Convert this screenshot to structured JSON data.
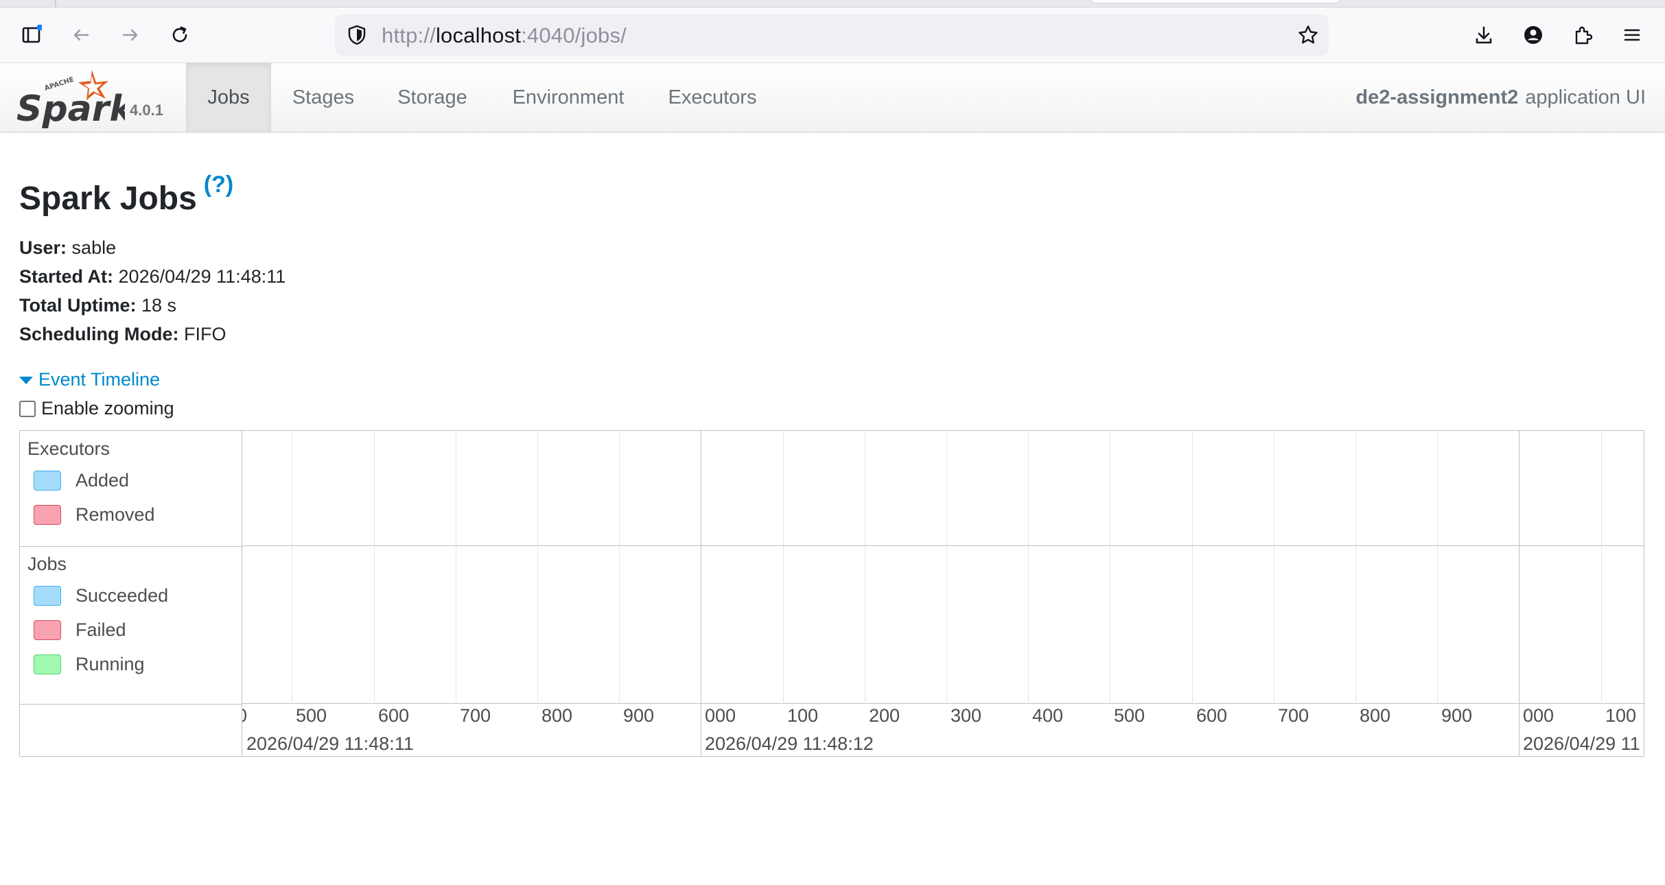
{
  "browser": {
    "url_scheme": "http://",
    "url_host": "localhost",
    "url_path": ":4040/jobs/"
  },
  "spark": {
    "version": "4.0.1",
    "nav_tabs": [
      "Jobs",
      "Stages",
      "Storage",
      "Environment",
      "Executors"
    ],
    "active_tab": "Jobs",
    "app_name": "de2-assignment2",
    "app_suffix": "application UI"
  },
  "page": {
    "title": "Spark Jobs",
    "help": "(?)",
    "summary": {
      "user_label": "User:",
      "user_value": "sable",
      "started_label": "Started At:",
      "started_value": "2026/04/29 11:48:11",
      "uptime_label": "Total Uptime:",
      "uptime_value": "18 s",
      "mode_label": "Scheduling Mode:",
      "mode_value": "FIFO"
    },
    "timeline_toggle": "Event Timeline",
    "zoom_label": "Enable zooming",
    "zoom_checked": false
  },
  "timeline": {
    "groups": [
      {
        "title": "Executors",
        "legend": [
          {
            "label": "Added",
            "color": "blue"
          },
          {
            "label": "Removed",
            "color": "red"
          }
        ]
      },
      {
        "title": "Jobs",
        "legend": [
          {
            "label": "Succeeded",
            "color": "blue"
          },
          {
            "label": "Failed",
            "color": "red"
          },
          {
            "label": "Running",
            "color": "green"
          }
        ]
      }
    ],
    "minor_ticks": [
      "0",
      "500",
      "600",
      "700",
      "800",
      "900",
      "000",
      "100",
      "200",
      "300",
      "400",
      "500",
      "600",
      "700",
      "800",
      "900",
      "000",
      "100"
    ],
    "major_ticks": [
      "2026/04/29 11:48:11",
      "2026/04/29 11:48:12",
      "2026/04/29 11"
    ]
  },
  "colors": {
    "link": "#0088cc",
    "legend_blue": "#a5dcfb",
    "legend_red": "#f9a2b0",
    "legend_green": "#a2f9b2"
  }
}
